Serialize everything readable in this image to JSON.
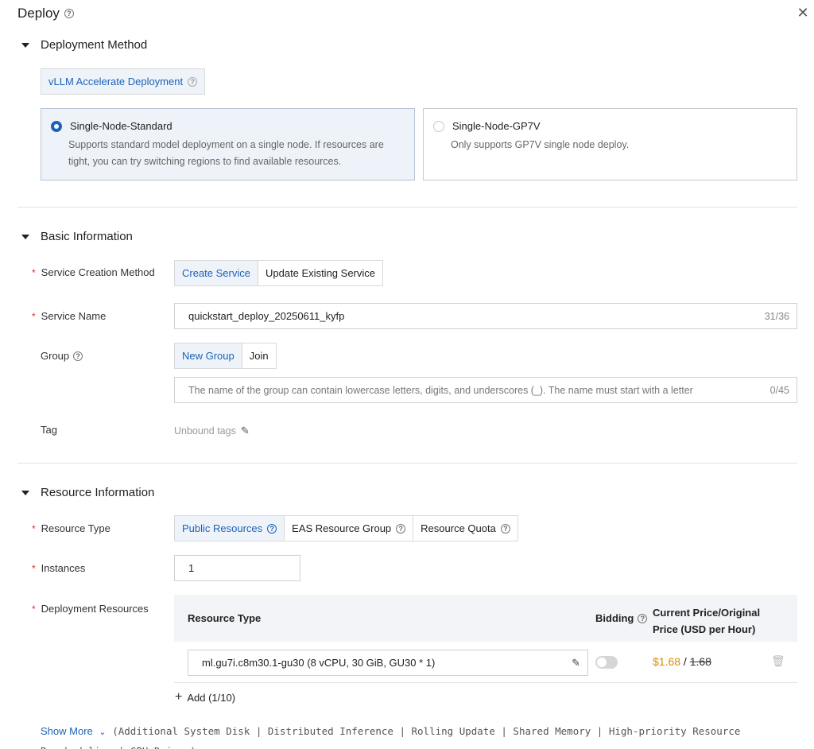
{
  "header": {
    "title": "Deploy",
    "help_icon": "question-circle-icon",
    "close_icon": "close-icon"
  },
  "deployment_method": {
    "heading": "Deployment Method",
    "tab_label": "vLLM Accelerate Deployment",
    "options": [
      {
        "title": "Single-Node-Standard",
        "desc": "Supports standard model deployment on a single node. If resources are tight, you can try switching regions to find available resources.",
        "selected": true
      },
      {
        "title": "Single-Node-GP7V",
        "desc": "Only supports GP7V single node deploy.",
        "selected": false
      }
    ]
  },
  "basic_info": {
    "heading": "Basic Information",
    "creation_method_label": "Service Creation Method",
    "creation_method_options": [
      "Create Service",
      "Update Existing Service"
    ],
    "service_name_label": "Service Name",
    "service_name_value": "quickstart_deploy_20250611_kyfp",
    "service_name_counter": "31/36",
    "group_label": "Group",
    "group_options": [
      "New Group",
      "Join"
    ],
    "group_placeholder": "The name of the group can contain lowercase letters, digits, and underscores (_). The name must start with a letter",
    "group_counter": "0/45",
    "tag_label": "Tag",
    "tag_value": "Unbound tags"
  },
  "resource_info": {
    "heading": "Resource Information",
    "resource_type_label": "Resource Type",
    "resource_type_options": [
      "Public Resources",
      "EAS Resource Group",
      "Resource Quota"
    ],
    "instances_label": "Instances",
    "instances_value": "1",
    "deployment_resources_label": "Deployment Resources",
    "table": {
      "col_resource_type": "Resource Type",
      "col_bidding": "Bidding",
      "col_price_line1": "Current Price/Original",
      "col_price_line2": "Price (USD per Hour)",
      "row_resource": "ml.gu7i.c8m30.1-gu30  (8 vCPU, 30 GiB, GU30 * 1)",
      "row_current_price": "$1.68",
      "row_separator": " / ",
      "row_original_price": "1.68"
    },
    "add_label": "Add (1/10)",
    "show_more_label": "Show More",
    "show_more_detail": "(Additional System Disk | Distributed Inference | Rolling Update | Shared Memory | High-priority Resource Rescheduling | GPU Driver)"
  },
  "colors": {
    "accent": "#1d62b8",
    "price": "#e08a00",
    "required": "#d0302f"
  }
}
